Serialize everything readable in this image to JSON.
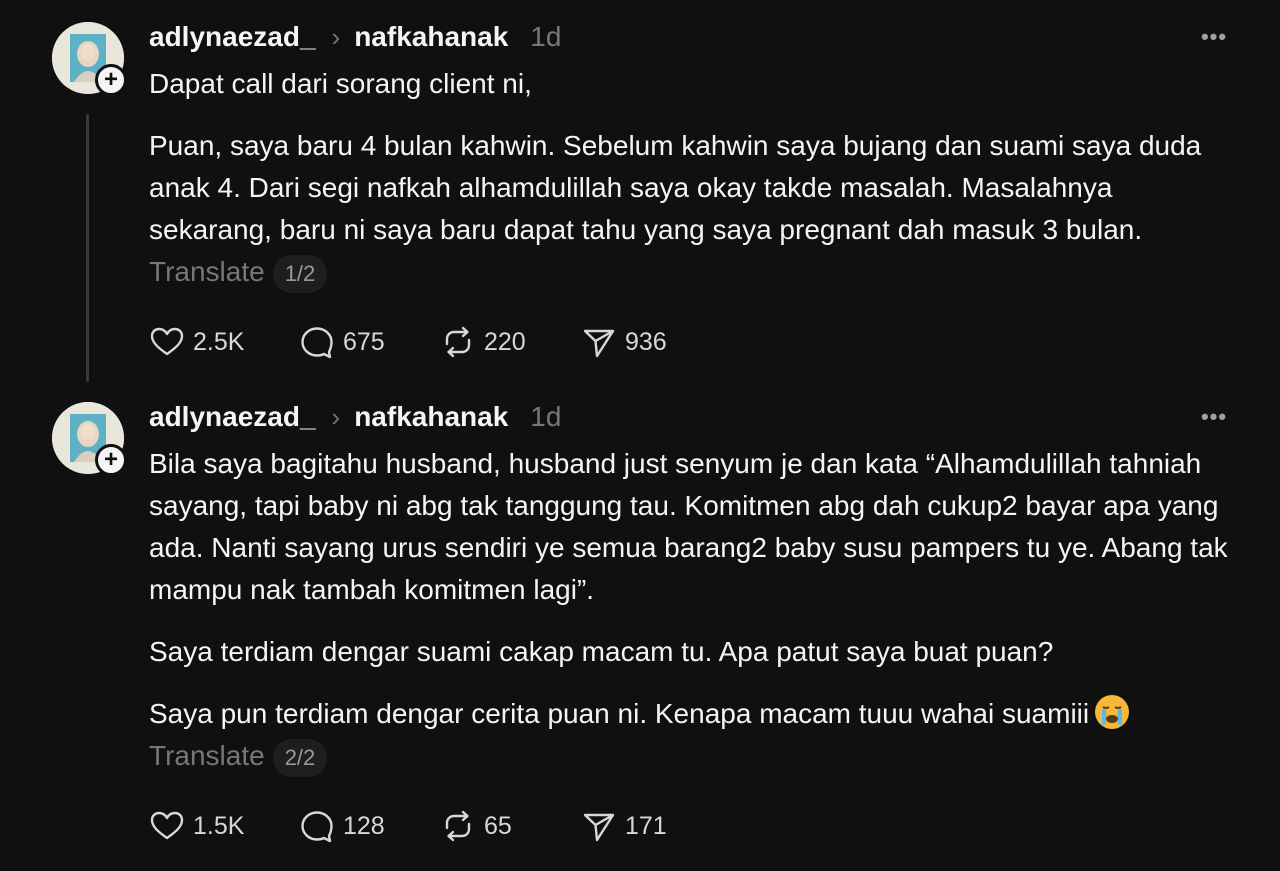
{
  "posts": [
    {
      "username": "adlynaezad_",
      "reply_target": "nafkahanak",
      "time": "1d",
      "paragraphs": [
        "Dapat call dari sorang client ni,",
        "Puan, saya baru 4 bulan kahwin. Sebelum kahwin saya bujang dan suami saya duda anak 4. Dari segi nafkah alhamdulillah saya okay takde masalah. Masalahnya sekarang, baru ni saya baru dapat tahu yang saya pregnant dah masuk 3 bulan."
      ],
      "translate_label": "Translate",
      "page_indicator": "1/2",
      "likes": "2.5K",
      "replies": "675",
      "reposts": "220",
      "shares": "936"
    },
    {
      "username": "adlynaezad_",
      "reply_target": "nafkahanak",
      "time": "1d",
      "paragraphs": [
        "Bila saya bagitahu husband, husband just senyum je dan kata “Alhamdulillah tahniah sayang, tapi baby ni abg tak tanggung tau. Komitmen abg dah cukup2 bayar apa yang ada. Nanti sayang urus sendiri ye semua barang2 baby susu pampers tu ye. Abang tak mampu nak tambah komitmen lagi”.",
        "Saya terdiam dengar suami cakap macam tu. Apa patut saya buat puan?",
        "Saya pun terdiam dengar cerita puan ni. Kenapa macam tuuu wahai suamiii"
      ],
      "emoji_name": "loudly-crying-face-emoji",
      "translate_label": "Translate",
      "page_indicator": "2/2",
      "likes": "1.5K",
      "replies": "128",
      "reposts": "65",
      "shares": "171"
    }
  ],
  "icons": {
    "more": "more-horizontal-icon",
    "like": "heart-icon",
    "reply": "comment-bubble-icon",
    "repost": "repost-arrows-icon",
    "share": "send-paper-plane-icon",
    "follow": "plus-icon"
  },
  "colors": {
    "background": "#101010",
    "text": "#f3f5f7",
    "muted": "#777777"
  }
}
